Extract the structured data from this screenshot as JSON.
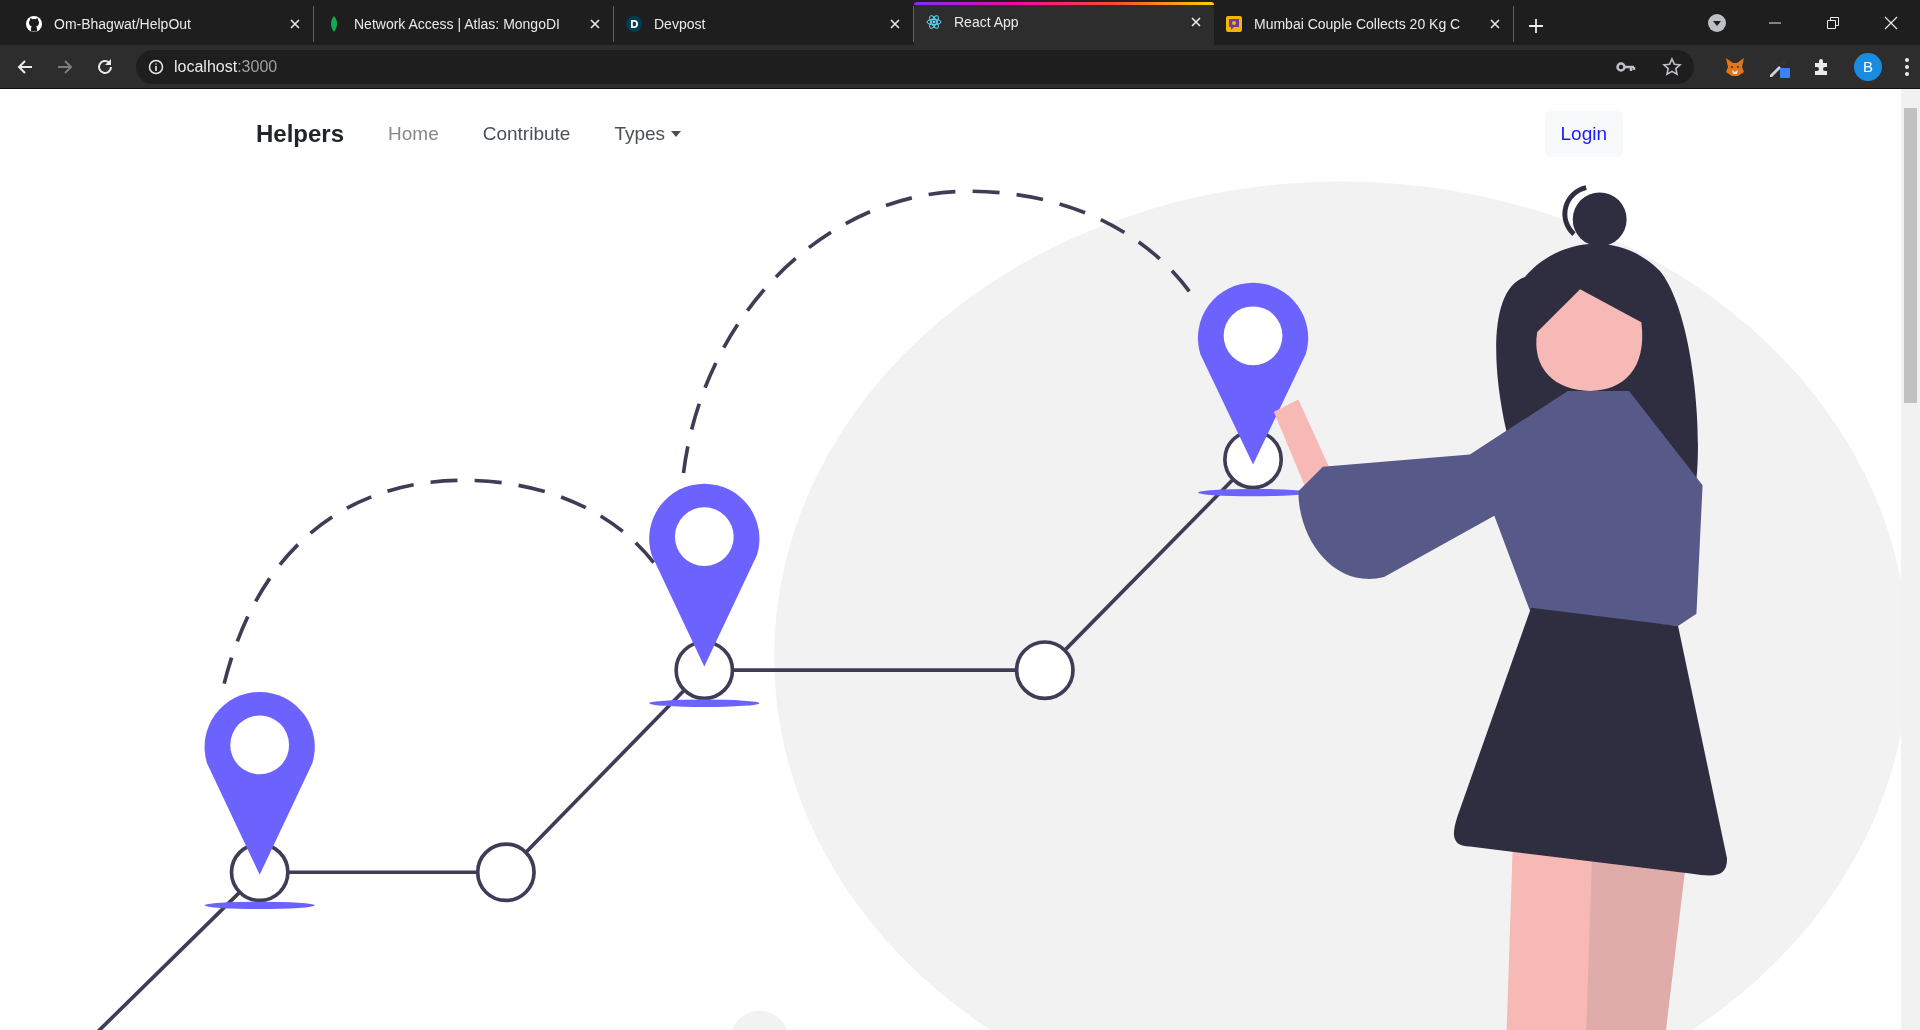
{
  "browser": {
    "tabs": [
      {
        "title": "Om-Bhagwat/HelpOut",
        "selected": false
      },
      {
        "title": "Network Access | Atlas: MongoDI",
        "selected": false
      },
      {
        "title": "Devpost",
        "selected": false
      },
      {
        "title": "React App",
        "selected": true
      },
      {
        "title": "Mumbai Couple Collects 20 Kg C",
        "selected": false
      }
    ],
    "address": {
      "host": "localhost",
      "port": ":3000"
    },
    "profile": "B"
  },
  "navbar": {
    "brand": "Helpers",
    "links": [
      {
        "label": "Home",
        "muted": true,
        "dropdown": false
      },
      {
        "label": "Contribute",
        "muted": false,
        "dropdown": false
      },
      {
        "label": "Types",
        "muted": false,
        "dropdown": true
      }
    ],
    "login": "Login"
  }
}
